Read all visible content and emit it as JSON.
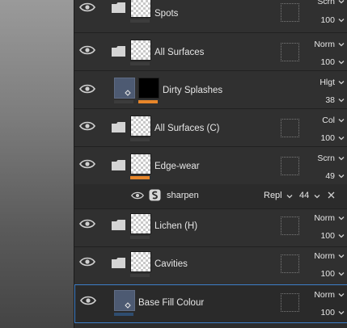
{
  "layers": [
    {
      "name": "Spots",
      "blend": "Scrn",
      "opacity": "100",
      "type": "folder",
      "mask_bar": "none"
    },
    {
      "name": "All Surfaces",
      "blend": "Norm",
      "opacity": "100",
      "type": "folder",
      "mask_bar": "none"
    },
    {
      "name": "Dirty Splashes",
      "blend": "Hlgt",
      "opacity": "38",
      "type": "fill",
      "mask_bar": "orange"
    },
    {
      "name": "All Surfaces (C)",
      "blend": "Col",
      "opacity": "100",
      "type": "folder",
      "mask_bar": "none"
    },
    {
      "name": "Edge-wear",
      "blend": "Scrn",
      "opacity": "49",
      "type": "folder",
      "mask_bar": "orange"
    },
    {
      "name": "Lichen (H)",
      "blend": "Norm",
      "opacity": "100",
      "type": "folder",
      "mask_bar": "none"
    },
    {
      "name": "Cavities",
      "blend": "Norm",
      "opacity": "100",
      "type": "folder",
      "mask_bar": "none"
    },
    {
      "name": "Base Fill Colour",
      "blend": "Norm",
      "opacity": "100",
      "type": "fill",
      "mask_bar": "none",
      "selected": true
    }
  ],
  "effect": {
    "name": "sharpen",
    "blend": "Repl",
    "value": "44"
  },
  "colors": {
    "accent_orange": "#e7862a",
    "selection_blue": "#3d7ec8"
  },
  "icons": {
    "visibility": "eye-icon",
    "folder": "folder-icon",
    "effect": "sharpen-icon",
    "remove": "close-icon",
    "dropdown": "chevron-down-icon"
  }
}
